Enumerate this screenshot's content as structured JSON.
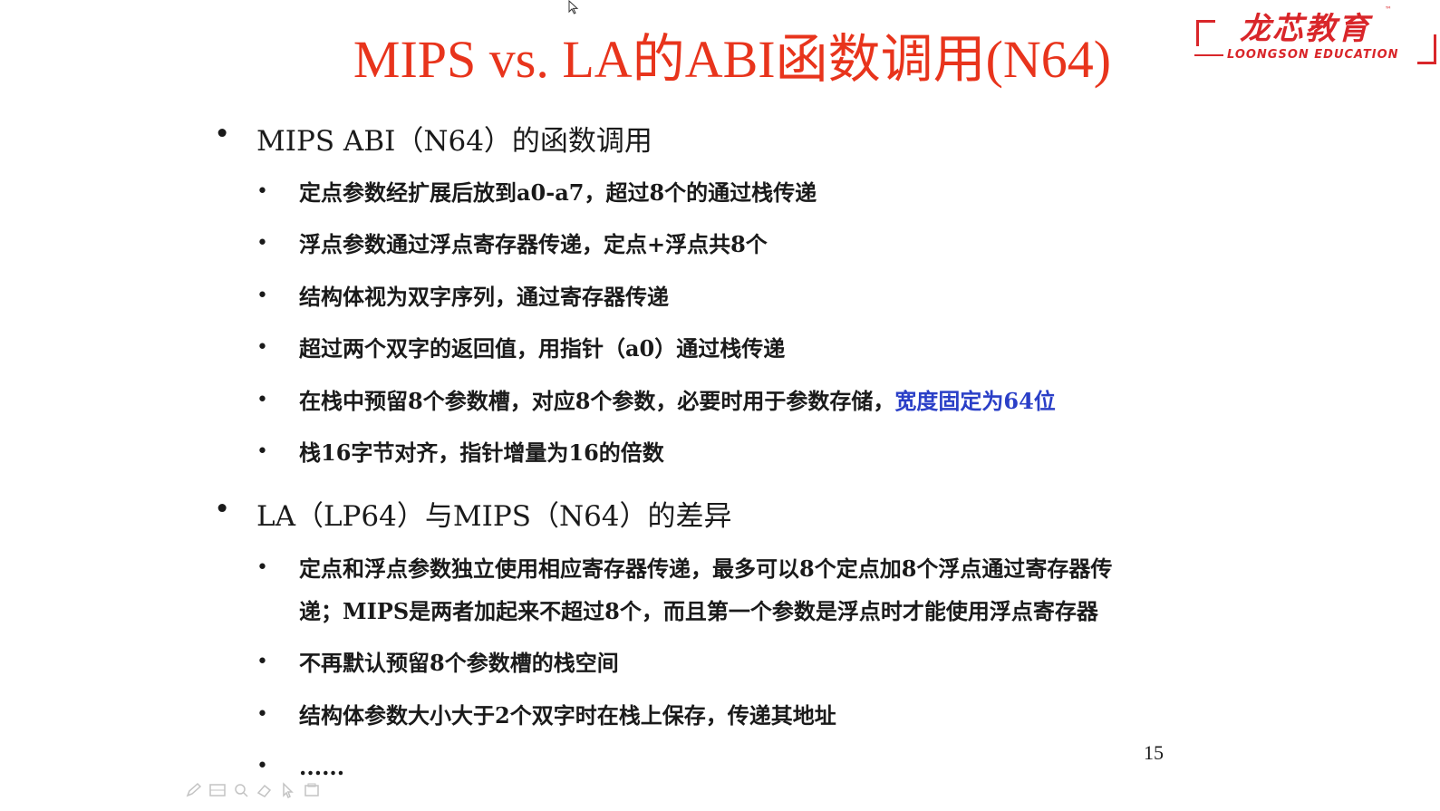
{
  "title": "MIPS vs. LA的ABI函数调用(N64)",
  "logo": {
    "cn": "龙芯教育",
    "en": "LOONGSON EDUCATION",
    "tm": "™"
  },
  "sections": [
    {
      "heading": "MIPS ABI（N64）的函数调用",
      "items": [
        {
          "text": "定点参数经扩展后放到a0-a7，超过8个的通过栈传递"
        },
        {
          "text": "浮点参数通过浮点寄存器传递，定点+浮点共8个"
        },
        {
          "text": "结构体视为双字序列，通过寄存器传递"
        },
        {
          "text": "超过两个双字的返回值，用指针（a0）通过栈传递"
        },
        {
          "text": "在栈中预留8个参数槽，对应8个参数，必要时用于参数存储，",
          "highlight": "宽度固定为64位"
        },
        {
          "text": "栈16字节对齐，指针增量为16的倍数"
        }
      ]
    },
    {
      "heading": "LA（LP64）与MIPS（N64）的差异",
      "items": [
        {
          "line1": "定点和浮点参数独立使用相应寄存器传递，最多可以8个定点加8个浮点通过寄存器传",
          "line2": "递；MIPS是两者加起来不超过8个，而且第一个参数是浮点时才能使用浮点寄存器"
        },
        {
          "text": "不再默认预留8个参数槽的栈空间"
        },
        {
          "text": "结构体参数大小大于2个双字时在栈上保存，传递其地址"
        },
        {
          "text": "......"
        }
      ]
    }
  ],
  "page_number": "15",
  "bullet": "•",
  "colors": {
    "title": "#e8341c",
    "highlight": "#2a3fc7",
    "logo": "#d9262a"
  }
}
